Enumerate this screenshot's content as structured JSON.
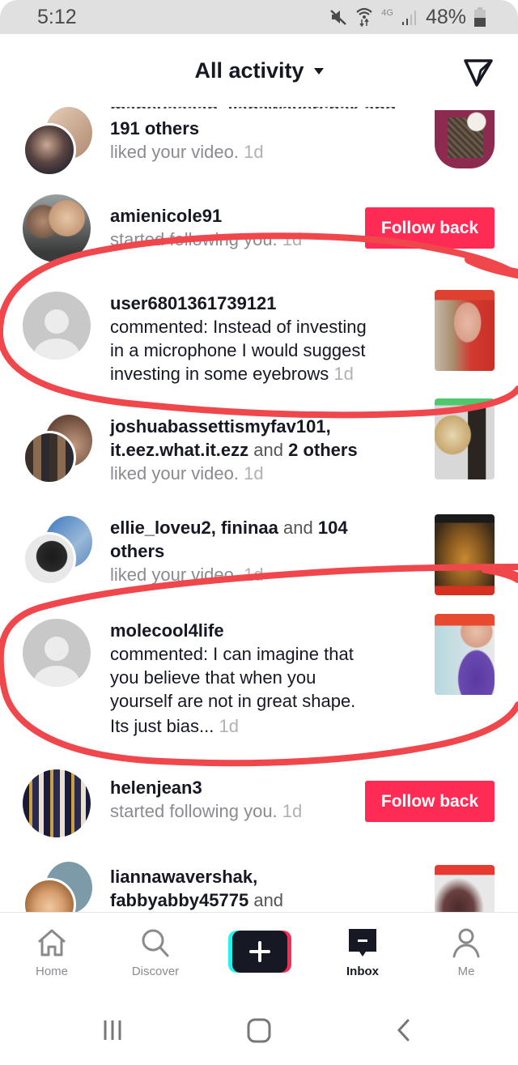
{
  "status_bar": {
    "time": "5:12",
    "network": "4G",
    "battery_percent": "48%",
    "icons": [
      "mute-icon",
      "wifi-icon",
      "signal-icon",
      "battery-icon"
    ]
  },
  "header": {
    "title": "All activity",
    "dropdown_icon": "caret-down-icon",
    "action_icon": "send-icon"
  },
  "colors": {
    "accent": "#fe2c55",
    "annotation": "#f0474d",
    "text_primary": "#161823",
    "text_secondary": "#8a8b91"
  },
  "feed": {
    "items": [
      {
        "type": "like",
        "line1_truncated": "maheuaaaan, lianawaversnak and",
        "line2": "191 others",
        "action": "liked your video.",
        "time": "1d"
      },
      {
        "type": "follow",
        "user": "amienicole91",
        "action": "started following you.",
        "time": "1d",
        "button": "Follow back"
      },
      {
        "type": "comment",
        "user": "user6801361739121",
        "comment_lines": [
          "commented: Instead of investing",
          "in a microphone I would suggest",
          "investing in some eyebrows"
        ],
        "time": "1d",
        "highlighted": true
      },
      {
        "type": "like",
        "user1": "joshuabassettismyfav101,",
        "user2": "it.eez.what.it.ezz",
        "conj": "and",
        "others": "2 others",
        "action": "liked your video.",
        "time": "1d"
      },
      {
        "type": "like",
        "user1": "ellie_loveu2,",
        "user2": "fininaa",
        "conj": "and",
        "count": "104",
        "others": "others",
        "action": "liked your video.",
        "time": "1d"
      },
      {
        "type": "comment",
        "user": "molecool4life",
        "comment_lines": [
          "commented: I can imagine that",
          "you believe that when you",
          "yourself are not in great shape.",
          "Its just bias..."
        ],
        "time": "1d",
        "highlighted": true
      },
      {
        "type": "follow",
        "user": "helenjean3",
        "action": "started following you.",
        "time": "1d",
        "button": "Follow back"
      },
      {
        "type": "like",
        "user1": "liannawavershak,",
        "user2": "fabbyabby45775",
        "conj": "and"
      }
    ]
  },
  "bottom_nav": {
    "items": [
      {
        "label": "Home",
        "icon": "home-icon"
      },
      {
        "label": "Discover",
        "icon": "search-icon"
      },
      {
        "label": "",
        "icon": "plus-icon"
      },
      {
        "label": "Inbox",
        "icon": "inbox-icon",
        "active": true
      },
      {
        "label": "Me",
        "icon": "profile-icon"
      }
    ]
  },
  "system_nav": {
    "items": [
      "recent-apps-icon",
      "home-circle-icon",
      "back-icon"
    ]
  }
}
